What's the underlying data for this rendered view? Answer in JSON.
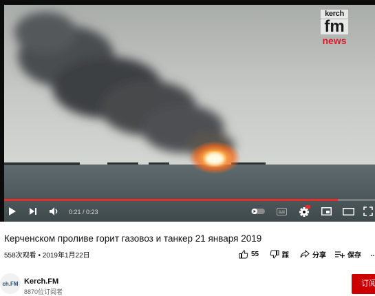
{
  "video": {
    "title": "Керченском проливе горит газовоз и танкер 21 января 2019",
    "time_display": "0:21 / 0:23",
    "progress": 0.9,
    "watermark": {
      "line1": "kerch",
      "line2": "fm",
      "line3": "news"
    },
    "views_date": "558次观看 • 2019年1月22日"
  },
  "actions": {
    "like_count": "55",
    "dislike_label": "踩",
    "share_label": "分享",
    "save_label": "保存",
    "more_label": "…"
  },
  "channel": {
    "avatar_text": "ch.FM",
    "name": "Kerch.FM",
    "subscribers": "8870位订阅者",
    "subscribe_label": "订阅"
  },
  "colors": {
    "progress": "#e52d27",
    "subscribe": "#cc0000",
    "brand_red": "#e0162b"
  },
  "icons": [
    "play-icon",
    "next-icon",
    "volume-icon",
    "autoplay-toggle-icon",
    "subtitles-icon",
    "settings-icon",
    "miniplayer-icon",
    "theater-icon",
    "fullscreen-icon",
    "like-icon",
    "dislike-icon",
    "share-icon",
    "save-icon"
  ]
}
